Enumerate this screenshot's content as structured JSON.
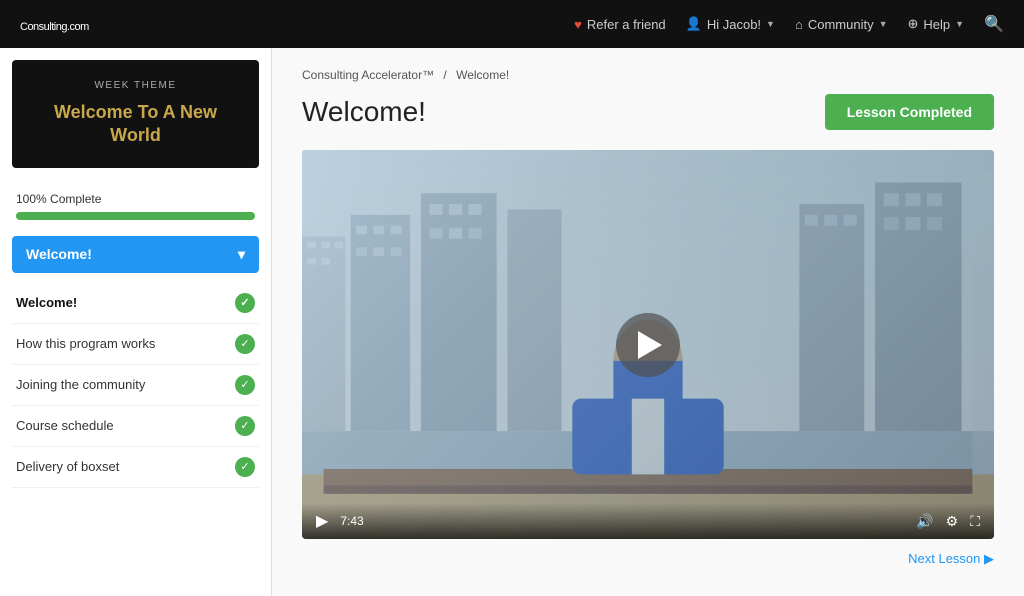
{
  "navbar": {
    "logo": "Consulting",
    "logo_suffix": ".com",
    "refer_label": "Refer a friend",
    "user_label": "Hi Jacob!",
    "community_label": "Community",
    "help_label": "Help"
  },
  "sidebar": {
    "week_label": "WEEK THEME",
    "week_title": "Welcome To A New World",
    "progress_label": "100% Complete",
    "progress_pct": 100,
    "dropdown_label": "Welcome!",
    "lessons": [
      {
        "label": "Welcome!",
        "completed": true,
        "active": true
      },
      {
        "label": "How this program works",
        "completed": true,
        "active": false
      },
      {
        "label": "Joining the community",
        "completed": true,
        "active": false
      },
      {
        "label": "Course schedule",
        "completed": true,
        "active": false
      },
      {
        "label": "Delivery of boxset",
        "completed": true,
        "active": false
      }
    ]
  },
  "main": {
    "breadcrumb_root": "Consulting Accelerator™",
    "breadcrumb_sep": "/",
    "breadcrumb_current": "Welcome!",
    "page_title": "Welcome!",
    "completed_btn": "Lesson Completed",
    "video_time": "7:43",
    "next_lesson": "Next Lesson ▶"
  }
}
